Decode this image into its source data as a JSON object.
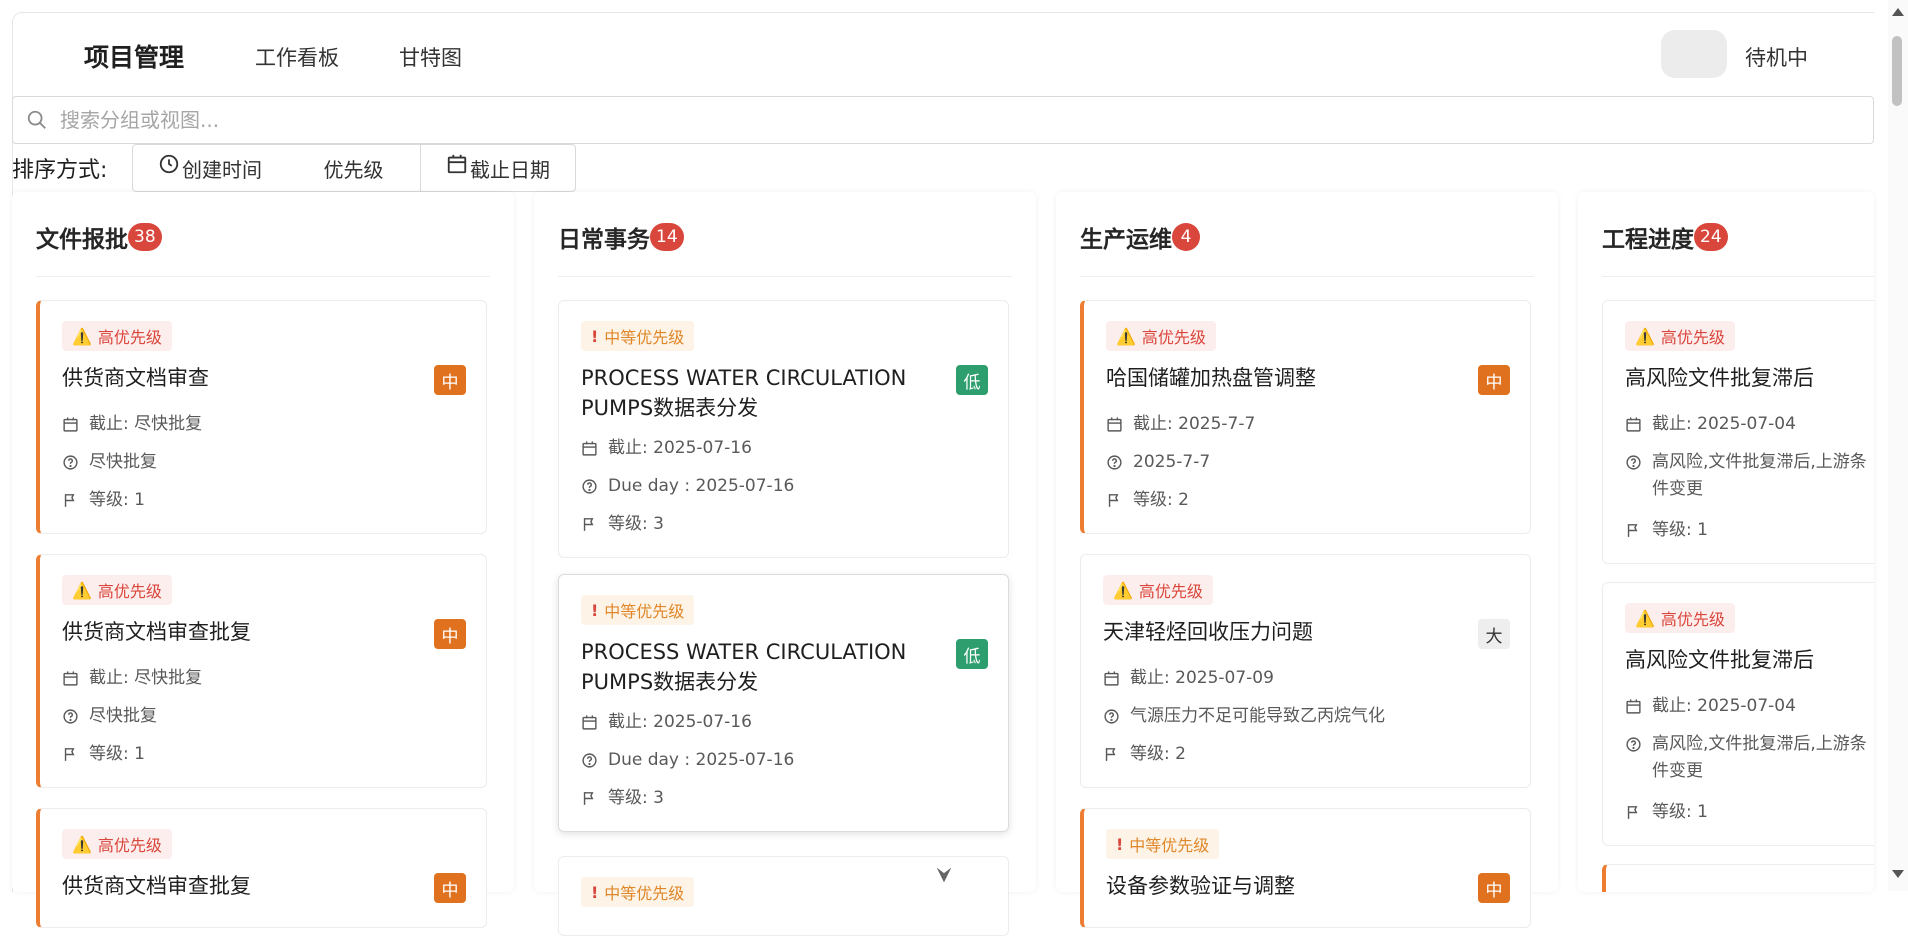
{
  "header": {
    "brand": "项目管理",
    "nav": [
      {
        "label": "工作看板"
      },
      {
        "label": "甘特图"
      }
    ],
    "status": "待机中"
  },
  "search": {
    "placeholder": "搜索分组或视图..."
  },
  "sort": {
    "label": "排序方式:",
    "options": [
      {
        "label": "创建时间",
        "icon": "clock-icon"
      },
      {
        "label": "优先级",
        "icon": ""
      },
      {
        "label": "截止日期",
        "icon": "calendar-icon"
      }
    ]
  },
  "colors": {
    "high_tag_bg": "#fdeeee",
    "high_tag_text": "#d9463b",
    "mid_tag_bg": "#fdf3e6",
    "mid_tag_text": "#e0872a",
    "count_badge": "#d9463b",
    "size_mid": "#e0721f",
    "size_low": "#2f9e6e",
    "accent": "#ed7d31"
  },
  "columns": [
    {
      "title": "文件报批",
      "count": "38",
      "cards": [
        {
          "tag": "高优先级",
          "title": "供货商文档审查",
          "size": "中",
          "deadline": "截止: 尽快批复",
          "desc": "尽快批复",
          "level": "等级: 1"
        },
        {
          "tag": "高优先级",
          "title": "供货商文档审查批复",
          "size": "中",
          "deadline": "截止: 尽快批复",
          "desc": "尽快批复",
          "level": "等级: 1"
        },
        {
          "tag": "高优先级",
          "title": "供货商文档审查批复",
          "size": "中"
        }
      ]
    },
    {
      "title": "日常事务",
      "count": "14",
      "cards": [
        {
          "tag": "中等优先级",
          "title_line1": "PROCESS WATER CIRCULATION",
          "title_line2": "PUMPS数据表分发",
          "size": "低",
          "deadline": "截止: 2025-07-16",
          "desc": "Due day : 2025-07-16",
          "level": "等级: 3"
        },
        {
          "tag": "中等优先级",
          "title_line1": "PROCESS WATER CIRCULATION",
          "title_line2": "PUMPS数据表分发",
          "size": "低",
          "deadline": "截止: 2025-07-16",
          "desc": "Due day : 2025-07-16",
          "level": "等级: 3"
        },
        {
          "tag": "中等优先级"
        }
      ]
    },
    {
      "title": "生产运维",
      "count": "4",
      "cards": [
        {
          "tag": "高优先级",
          "title": "哈国储罐加热盘管调整",
          "size": "中",
          "deadline": "截止: 2025-7-7",
          "desc": "2025-7-7",
          "level": "等级: 2"
        },
        {
          "tag": "高优先级",
          "title": "天津轻烃回收压力问题",
          "size": "大",
          "deadline": "截止: 2025-07-09",
          "desc": "气源压力不足可能导致乙丙烷气化",
          "level": "等级: 2"
        },
        {
          "tag": "中等优先级",
          "title": "设备参数验证与调整",
          "size": "中"
        }
      ]
    },
    {
      "title": "工程进度",
      "count": "24",
      "cards": [
        {
          "tag": "高优先级",
          "title": "高风险文件批复滞后",
          "deadline": "截止: 2025-07-04",
          "desc": "高风险,文件批复滞后,上游条件变更",
          "level": "等级: 1"
        },
        {
          "tag": "高优先级",
          "title": "高风险文件批复滞后",
          "deadline": "截止: 2025-07-04",
          "desc": "高风险,文件批复滞后,上游条件变更",
          "level": "等级: 1"
        }
      ]
    }
  ]
}
